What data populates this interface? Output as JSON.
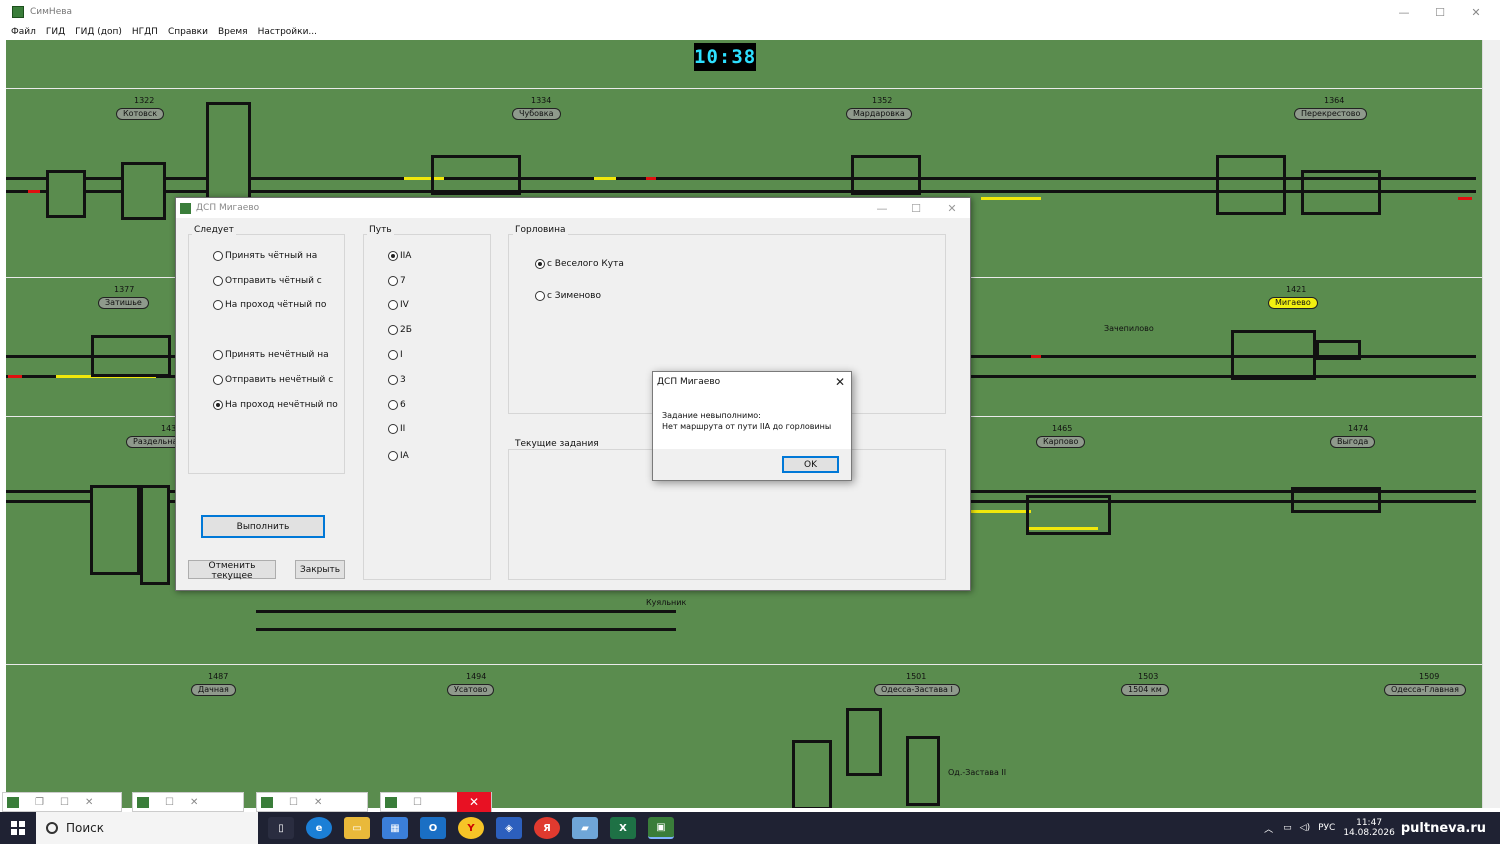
{
  "window": {
    "title": "СимНева",
    "minimize": "—",
    "maximize": "☐",
    "close": "✕"
  },
  "menu": [
    "Файл",
    "ГИД",
    "ГИД (доп)",
    "НГДП",
    "Справки",
    "Время",
    "Настройки..."
  ],
  "clock": "10:38",
  "stations": [
    {
      "num": "1322",
      "name": "Котовск"
    },
    {
      "num": "1334",
      "name": "Чубовка"
    },
    {
      "num": "1352",
      "name": "Мардаровка"
    },
    {
      "num": "1364",
      "name": "Перекрестово"
    },
    {
      "num": "1377",
      "name": "Затишье"
    },
    {
      "num": "1421",
      "name": "Мигаево"
    },
    {
      "num": "143",
      "name": "Раздельна"
    },
    {
      "num": "1465",
      "name": "Карпово"
    },
    {
      "num": "1474",
      "name": "Выгода"
    },
    {
      "num": "1487",
      "name": "Дачная"
    },
    {
      "num": "1494",
      "name": "Усатово"
    },
    {
      "num": "1501",
      "name": "Одесса-Застава I"
    },
    {
      "num": "1503",
      "name": "1504 км"
    },
    {
      "num": "1509",
      "name": "Одесса-Главная"
    }
  ],
  "map_labels": {
    "kuyalnik": "Куяльник",
    "zachepilovo": "Зачепилово",
    "od_zastava2": "Од.-Застава II"
  },
  "dialog": {
    "title": "ДСП Мигаево",
    "follows_group": "Следует",
    "follows_options": [
      {
        "label": "Принять чётный на",
        "checked": false
      },
      {
        "label": "Отправить чётный с",
        "checked": false
      },
      {
        "label": "На проход чётный по",
        "checked": false
      },
      {
        "label": "Принять нечётный на",
        "checked": false
      },
      {
        "label": "Отправить нечётный с",
        "checked": false
      },
      {
        "label": "На проход нечётный по",
        "checked": true
      }
    ],
    "track_group": "Путь",
    "track_options": [
      {
        "label": "IIA",
        "checked": true
      },
      {
        "label": "7",
        "checked": false
      },
      {
        "label": "IV",
        "checked": false
      },
      {
        "label": "2Б",
        "checked": false
      },
      {
        "label": "I",
        "checked": false
      },
      {
        "label": "3",
        "checked": false
      },
      {
        "label": "6",
        "checked": false
      },
      {
        "label": "II",
        "checked": false
      },
      {
        "label": "IA",
        "checked": false
      }
    ],
    "throat_group": "Горловина",
    "throat_options": [
      {
        "label": "с Веселого Кута",
        "checked": true
      },
      {
        "label": "с Зименово",
        "checked": false
      }
    ],
    "current_tasks_group": "Текущие задания",
    "execute": "Выполнить",
    "cancel_current": "Отменить текущее",
    "close": "Закрыть"
  },
  "message": {
    "title": "ДСП Мигаево",
    "line1": "Задание невыполнимо:",
    "line2": "Нет маршрута от пути IIA до горловины",
    "ok": "OK"
  },
  "taskbar": {
    "search": "Поиск",
    "lang": "РУС",
    "time": "11:47",
    "date": "14.08.2026",
    "watermark": "pultneva.ru"
  },
  "colors": {
    "canvas": "#5a8c4e",
    "track": "#111111",
    "route": "#f1e80b",
    "signal_red": "#e01010",
    "highlight_station": "#f3f010",
    "clock": "#2ee0ff"
  }
}
